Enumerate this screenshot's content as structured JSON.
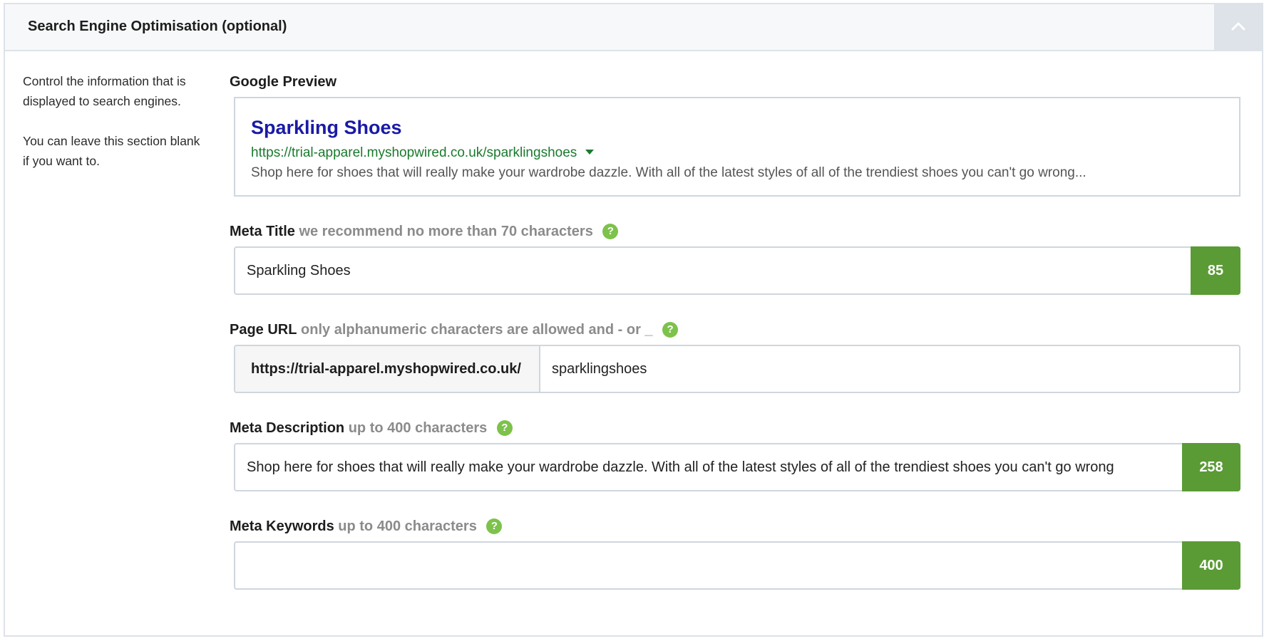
{
  "panel": {
    "title": "Search Engine Optimisation (optional)"
  },
  "side_note": {
    "line1": "Control the information that is displayed to search engines.",
    "line2": "You can leave this section blank if you want to."
  },
  "google_preview": {
    "label": "Google Preview",
    "title": "Sparkling Shoes",
    "url": "https://trial-apparel.myshopwired.co.uk/sparklingshoes",
    "description": "Shop here for shoes that will really make your wardrobe dazzle. With all of the latest styles of all of the trendiest shoes you can't go wrong..."
  },
  "meta_title": {
    "label": "Meta Title",
    "hint": "we recommend no more than 70 characters",
    "value": "Sparkling Shoes",
    "counter": "85"
  },
  "page_url": {
    "label": "Page URL",
    "hint": "only alphanumeric characters are allowed and - or _",
    "prefix": "https://trial-apparel.myshopwired.co.uk/",
    "value": "sparklingshoes"
  },
  "meta_description": {
    "label": "Meta Description",
    "hint": "up to 400 characters",
    "value": "Shop here for shoes that will really make your wardrobe dazzle. With all of the latest styles of all of the trendiest shoes you can't go wrong",
    "counter": "258"
  },
  "meta_keywords": {
    "label": "Meta Keywords",
    "hint": "up to 400 characters",
    "value": "",
    "counter": "400"
  },
  "colors": {
    "counter_green": "#5a9b35",
    "help_green": "#7dc24b",
    "link_blue": "#1a1aa6",
    "url_green": "#1a7a2e"
  },
  "icons": {
    "collapse": "chevron-up-icon",
    "help": "help-icon",
    "url_dropdown": "caret-down-icon"
  }
}
